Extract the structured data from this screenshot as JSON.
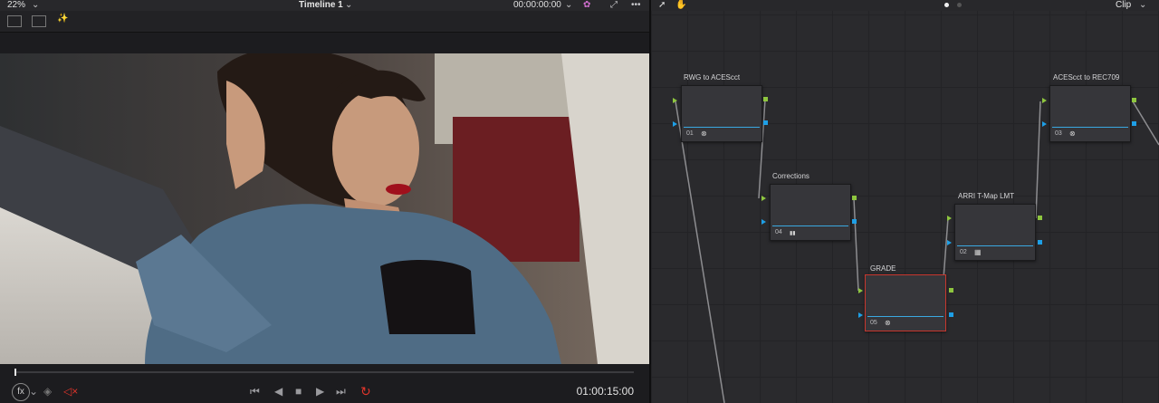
{
  "viewer": {
    "zoom": "22%",
    "timeline": "Timeline 1",
    "timecode_top": "00:00:00:00",
    "timecode_bottom": "01:00:15:00",
    "fx": "fx"
  },
  "transport": {
    "first": "⏮",
    "prev": "◀",
    "stop": "■",
    "play": "▶",
    "last": "⏭",
    "loop": "↻"
  },
  "node_editor": {
    "mode": "Clip",
    "nodes": [
      {
        "label": "RWG to ACEScct",
        "num": "01",
        "icon": "⊗"
      },
      {
        "label": "Corrections",
        "num": "04",
        "icon": "▮▮"
      },
      {
        "label": "GRADE",
        "num": "05",
        "icon": "⊗"
      },
      {
        "label": "ARRI T-Map LMT",
        "num": "02",
        "icon": "▦"
      },
      {
        "label": "ACEScct to REC709",
        "num": "03",
        "icon": "⊗"
      }
    ]
  },
  "colors": {
    "accent_blue": "#1e9fe6",
    "port_green": "#8ec63f",
    "selected_red": "#c8372e",
    "bypass_red": "#e0352b"
  }
}
